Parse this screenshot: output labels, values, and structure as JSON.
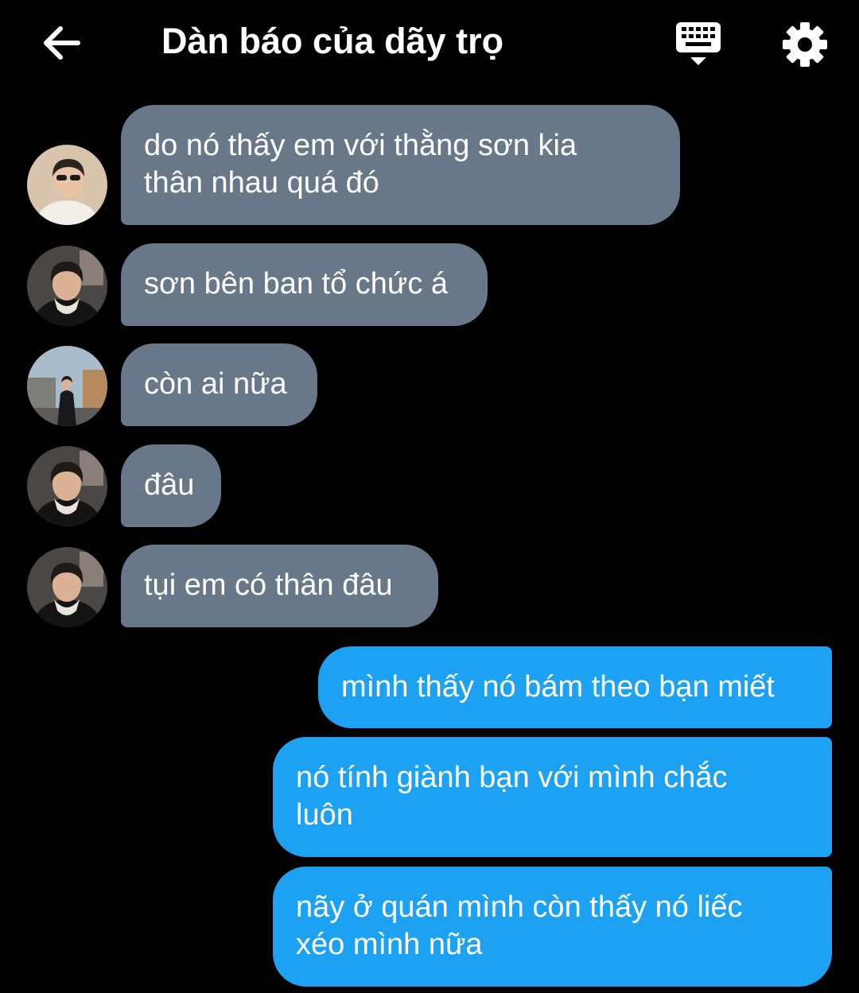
{
  "header": {
    "title": "Dàn báo của dãy trọ",
    "back_icon": "arrow-left-icon",
    "keyboard_icon": "keyboard-icon",
    "settings_icon": "gear-icon"
  },
  "messages": [
    {
      "direction": "incoming",
      "text": "do nó thấy em với thằng sơn kia\nthân nhau quá đó"
    },
    {
      "direction": "incoming",
      "text": "sơn bên ban tổ chức á"
    },
    {
      "direction": "incoming",
      "text": "còn ai nữa"
    },
    {
      "direction": "incoming",
      "text": "đâu"
    },
    {
      "direction": "incoming",
      "text": "tụi em có thân đâu"
    },
    {
      "direction": "outgoing",
      "text": "mình thấy nó bám theo bạn miết"
    },
    {
      "direction": "outgoing",
      "text": "nó tính giành bạn với mình chắc\nluôn"
    },
    {
      "direction": "outgoing",
      "text": "nãy ở quán mình còn thấy nó liếc\nxéo mình nữa"
    }
  ],
  "colors": {
    "background": "#000000",
    "incoming_bubble": "#687888",
    "outgoing_bubble": "#1da1f2",
    "text": "#ffffff"
  }
}
